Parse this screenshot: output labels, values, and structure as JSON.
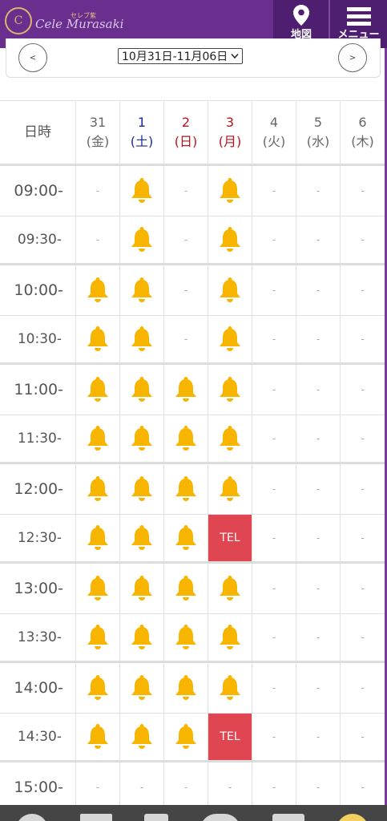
{
  "header": {
    "logo_text": "Cele Murasaki",
    "logo_sub": "セレブ紫",
    "map_label": "地図",
    "menu_label": "メニュー"
  },
  "date_nav": {
    "prev_label": "<",
    "next_label": ">",
    "range_label": "10月31日-11月06日"
  },
  "table": {
    "corner_label": "日時",
    "days": [
      {
        "num": "31",
        "dow": "(金)",
        "color": "gray"
      },
      {
        "num": "1",
        "dow": "(土)",
        "color": "blue"
      },
      {
        "num": "2",
        "dow": "(日)",
        "color": "red"
      },
      {
        "num": "3",
        "dow": "(月)",
        "color": "red"
      },
      {
        "num": "4",
        "dow": "(火)",
        "color": "gray"
      },
      {
        "num": "5",
        "dow": "(水)",
        "color": "gray"
      },
      {
        "num": "6",
        "dow": "(木)",
        "color": "gray"
      }
    ],
    "rows": [
      {
        "time": "09:00-",
        "cells": [
          "-",
          "bell",
          "-",
          "bell",
          "-",
          "-",
          "-"
        ]
      },
      {
        "time": "09:30-",
        "cells": [
          "-",
          "bell",
          "-",
          "bell",
          "-",
          "-",
          "-"
        ]
      },
      {
        "time": "10:00-",
        "cells": [
          "bell",
          "bell",
          "-",
          "bell",
          "-",
          "-",
          "-"
        ]
      },
      {
        "time": "10:30-",
        "cells": [
          "bell",
          "bell",
          "-",
          "bell",
          "-",
          "-",
          "-"
        ]
      },
      {
        "time": "11:00-",
        "cells": [
          "bell",
          "bell",
          "bell",
          "bell",
          "-",
          "-",
          "-"
        ]
      },
      {
        "time": "11:30-",
        "cells": [
          "bell",
          "bell",
          "bell",
          "bell",
          "-",
          "-",
          "-"
        ]
      },
      {
        "time": "12:00-",
        "cells": [
          "bell",
          "bell",
          "bell",
          "bell",
          "-",
          "-",
          "-"
        ]
      },
      {
        "time": "12:30-",
        "cells": [
          "bell",
          "bell",
          "bell",
          "TEL",
          "-",
          "-",
          "-"
        ]
      },
      {
        "time": "13:00-",
        "cells": [
          "bell",
          "bell",
          "bell",
          "bell",
          "-",
          "-",
          "-"
        ]
      },
      {
        "time": "13:30-",
        "cells": [
          "bell",
          "bell",
          "bell",
          "bell",
          "-",
          "-",
          "-"
        ]
      },
      {
        "time": "14:00-",
        "cells": [
          "bell",
          "bell",
          "bell",
          "bell",
          "-",
          "-",
          "-"
        ]
      },
      {
        "time": "14:30-",
        "cells": [
          "bell",
          "bell",
          "bell",
          "TEL",
          "-",
          "-",
          "-"
        ]
      },
      {
        "time": "15:00-",
        "cells": [
          "-",
          "-",
          "-",
          "-",
          "-",
          "-",
          "-"
        ]
      }
    ]
  },
  "colors": {
    "header_bg": "#6a2e8f",
    "bell": "#f7b500",
    "tel_bg": "#e04552",
    "dow_blue": "#1a2a9c",
    "dow_red": "#b5121b"
  }
}
